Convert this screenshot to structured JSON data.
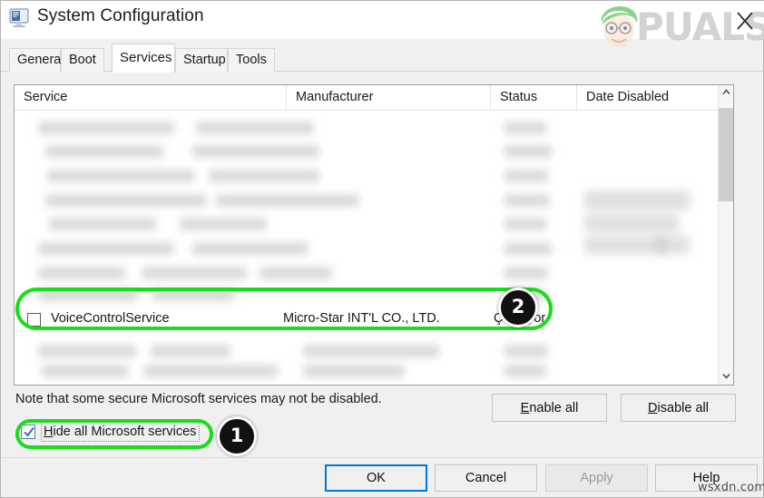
{
  "window": {
    "title": "System Configuration",
    "icon": "monitor-config-icon",
    "close_label": "✕"
  },
  "branding": {
    "logo_text": "PUALS",
    "watermark": "wsxdn.com"
  },
  "tabs": [
    {
      "label": "General",
      "active": false
    },
    {
      "label": "Boot",
      "active": false
    },
    {
      "label": "Services",
      "active": true
    },
    {
      "label": "Startup",
      "active": false
    },
    {
      "label": "Tools",
      "active": false
    }
  ],
  "service_list": {
    "columns": [
      "Service",
      "Manufacturer",
      "Status",
      "Date Disabled"
    ],
    "selected_row": {
      "checked": false,
      "service": "VoiceControlService",
      "manufacturer": "Micro-Star INT'L CO., LTD.",
      "status": "Çalışıyor",
      "date_disabled": ""
    },
    "scrollbar": {
      "up_arrow": "chevron-up-icon",
      "down_arrow": "chevron-down-icon"
    }
  },
  "footer": {
    "note": "Note that some secure Microsoft services may not be disabled.",
    "hide_microsoft": {
      "label": "Hide all Microsoft services",
      "accelerator": "H",
      "checked": true
    },
    "enable_all": {
      "label": "Enable all",
      "accelerator": "E"
    },
    "disable_all": {
      "label": "Disable all",
      "accelerator": "D"
    }
  },
  "dialog_buttons": {
    "ok": "OK",
    "cancel": "Cancel",
    "apply": "Apply",
    "apply_disabled": true,
    "help": "Help"
  },
  "annotations": {
    "highlight_color": "#18dd18",
    "badges": [
      {
        "number": "1",
        "target": "hide-all-microsoft-services-checkbox"
      },
      {
        "number": "2",
        "target": "voicecontrolservice-row-status"
      }
    ]
  }
}
